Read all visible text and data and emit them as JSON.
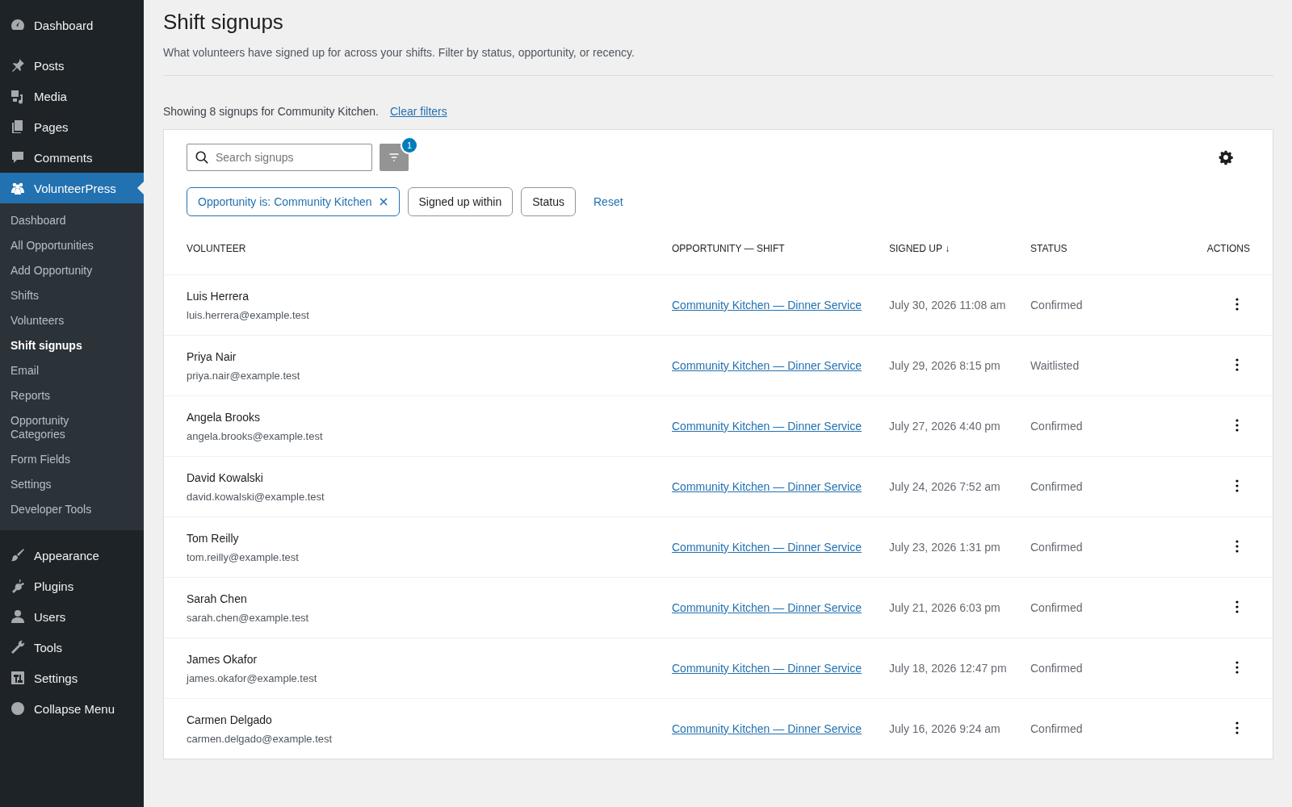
{
  "sidebar": {
    "items": [
      {
        "label": "Dashboard",
        "selected": false
      },
      {
        "label": "Posts",
        "selected": false
      },
      {
        "label": "Media",
        "selected": false
      },
      {
        "label": "Pages",
        "selected": false
      },
      {
        "label": "Comments",
        "selected": false
      },
      {
        "label": "VolunteerPress",
        "selected": true,
        "children": [
          {
            "label": "Dashboard",
            "selected": false
          },
          {
            "label": "All Opportunities",
            "selected": false
          },
          {
            "label": "Add Opportunity",
            "selected": false
          },
          {
            "label": "Shifts",
            "selected": false
          },
          {
            "label": "Volunteers",
            "selected": false
          },
          {
            "label": "Shift signups",
            "selected": true
          },
          {
            "label": "Email",
            "selected": false
          },
          {
            "label": "Reports",
            "selected": false
          },
          {
            "label": "Opportunity Categories",
            "selected": false
          },
          {
            "label": "Form Fields",
            "selected": false
          },
          {
            "label": "Settings",
            "selected": false
          },
          {
            "label": "Developer Tools",
            "selected": false
          }
        ]
      },
      {
        "label": "Appearance",
        "selected": false
      },
      {
        "label": "Plugins",
        "selected": false
      },
      {
        "label": "Users",
        "selected": false
      },
      {
        "label": "Tools",
        "selected": false
      },
      {
        "label": "Settings",
        "selected": false
      },
      {
        "label": "Collapse Menu",
        "selected": false
      }
    ]
  },
  "page": {
    "title": "Shift signups",
    "description": "What volunteers have signed up for across your shifts. Filter by status, opportunity, or recency.",
    "summary": "Showing 8 signups for Community Kitchen.",
    "clear_link": "Clear filters"
  },
  "toolbar": {
    "search": {
      "placeholder": "Search signups"
    },
    "filter_badge": "1",
    "filters": [
      {
        "label": "Opportunity is: Community Kitchen",
        "active": true
      },
      {
        "label": "Signed up within",
        "active": false
      },
      {
        "label": "Status",
        "active": false
      }
    ],
    "reset": "Reset"
  },
  "table": {
    "columns": [
      "VOLUNTEER",
      "OPPORTUNITY — SHIFT",
      "SIGNED UP ↓",
      "STATUS",
      "ACTIONS"
    ],
    "rows": [
      {
        "name": "Luis Herrera",
        "email": "luis.herrera@example.test",
        "shift": "Community Kitchen — Dinner Service",
        "signed_up": "July 30, 2026 11:08 am",
        "status": "Confirmed"
      },
      {
        "name": "Priya Nair",
        "email": "priya.nair@example.test",
        "shift": "Community Kitchen — Dinner Service",
        "signed_up": "July 29, 2026 8:15 pm",
        "status": "Waitlisted"
      },
      {
        "name": "Angela Brooks",
        "email": "angela.brooks@example.test",
        "shift": "Community Kitchen — Dinner Service",
        "signed_up": "July 27, 2026 4:40 pm",
        "status": "Confirmed"
      },
      {
        "name": "David Kowalski",
        "email": "david.kowalski@example.test",
        "shift": "Community Kitchen — Dinner Service",
        "signed_up": "July 24, 2026 7:52 am",
        "status": "Confirmed"
      },
      {
        "name": "Tom Reilly",
        "email": "tom.reilly@example.test",
        "shift": "Community Kitchen — Dinner Service",
        "signed_up": "July 23, 2026 1:31 pm",
        "status": "Confirmed"
      },
      {
        "name": "Sarah Chen",
        "email": "sarah.chen@example.test",
        "shift": "Community Kitchen — Dinner Service",
        "signed_up": "July 21, 2026 6:03 pm",
        "status": "Confirmed"
      },
      {
        "name": "James Okafor",
        "email": "james.okafor@example.test",
        "shift": "Community Kitchen — Dinner Service",
        "signed_up": "July 18, 2026 12:47 pm",
        "status": "Confirmed"
      },
      {
        "name": "Carmen Delgado",
        "email": "carmen.delgado@example.test",
        "shift": "Community Kitchen — Dinner Service",
        "signed_up": "July 16, 2026 9:24 am",
        "status": "Confirmed"
      }
    ]
  }
}
